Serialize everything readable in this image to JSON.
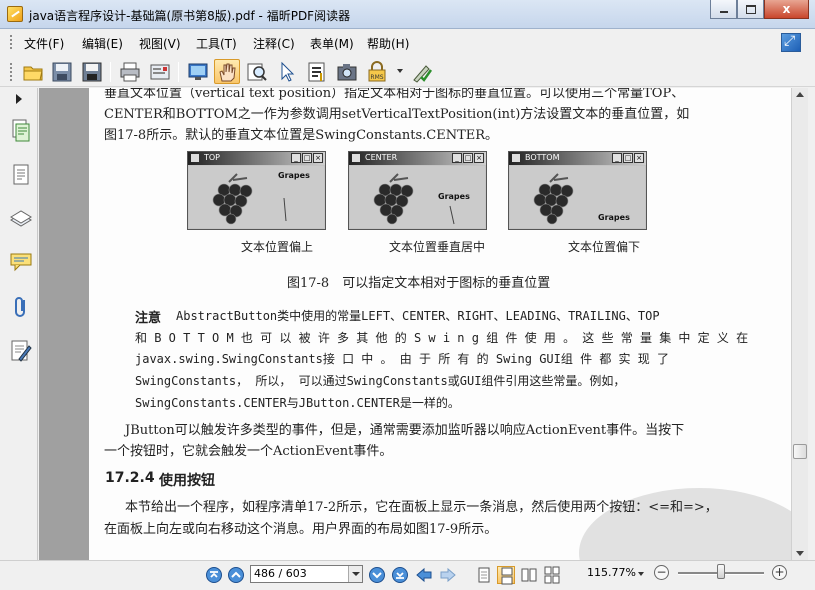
{
  "window": {
    "title": "java语言程序设计-基础篇(原书第8版).pdf - 福昕PDF阅读器",
    "close_label": "x"
  },
  "menu": {
    "items": [
      {
        "label": "文件(F)"
      },
      {
        "label": "编辑(E)"
      },
      {
        "label": "视图(V)"
      },
      {
        "label": "工具(T)"
      },
      {
        "label": "注释(C)"
      },
      {
        "label": "表单(M)"
      },
      {
        "label": "帮助(H)"
      }
    ]
  },
  "toolbar": {
    "buttons": [
      "open-icon",
      "save-icon",
      "save-as-icon",
      "print-icon",
      "email-icon",
      "fullscreen-icon",
      "hand-tool-icon",
      "zoom-tool-icon",
      "select-tool-icon",
      "text-select-icon",
      "snapshot-icon",
      "rms-icon",
      "sign-icon"
    ],
    "rms_label": "RMS",
    "active_tool": "hand-tool-icon"
  },
  "leftpanel": {
    "items": [
      "pages-icon",
      "bookmarks-icon",
      "layers-icon",
      "comments-icon",
      "attachments-icon",
      "signatures-icon"
    ]
  },
  "document": {
    "line1": "垂直文本位置（vertical text position）指定文本相对于图标的垂直位置。可以使用三个常量TOP、",
    "line2": "CENTER和BOTTOM之一作为参数调用setVerticalTextPosition(int)方法设置文本的垂直位置，如",
    "line3": "图17-8所示。默认的垂直文本位置是SwingConstants.CENTER。",
    "figures": [
      {
        "title": "TOP",
        "label": "Grapes",
        "caption": "文本位置偏上"
      },
      {
        "title": "CENTER",
        "label": "Grapes",
        "caption": "文本位置垂直居中"
      },
      {
        "title": "BOTTOM",
        "label": "Grapes",
        "caption": "文本位置偏下"
      }
    ],
    "figure_caption": "图17-8　可以指定文本相对于图标的垂直位置",
    "note_label": "注意",
    "note1": "AbstractButton类中使用的常量LEFT、CENTER、RIGHT、LEADING、TRAILING、TOP",
    "note2": "和 B O T T O M 也 可 以 被 许 多 其 他 的 S w i n g 组 件 使 用 。 这 些 常 量 集 中 定 义 在",
    "note3": "javax.swing.SwingConstants接 口 中 。 由 于 所 有 的 Swing GUI组 件 都 实 现 了",
    "note4": "SwingConstants， 所以， 可以通过SwingConstants或GUI组件引用这些常量。例如，",
    "note5": "SwingConstants.CENTER与JButton.CENTER是一样的。",
    "para1": "JButton可以触发许多类型的事件，但是，通常需要添加监听器以响应ActionEvent事件。当按下",
    "para2": "一个按钮时，它就会触发一个ActionEvent事件。",
    "section_num": "17.2.4",
    "section_title": "使用按钮",
    "para3": "本节给出一个程序，如程序清单17-2所示，它在面板上显示一条消息，然后使用两个按钮：<=和=>，",
    "para4": "在面板上向左或向右移动这个消息。用户界面的布局如图17-9所示。"
  },
  "status": {
    "page_value": "486 / 603",
    "zoom": "115.77%",
    "zoom_minus": "−",
    "zoom_plus": "+",
    "zoom_slider_level": 0.5
  }
}
